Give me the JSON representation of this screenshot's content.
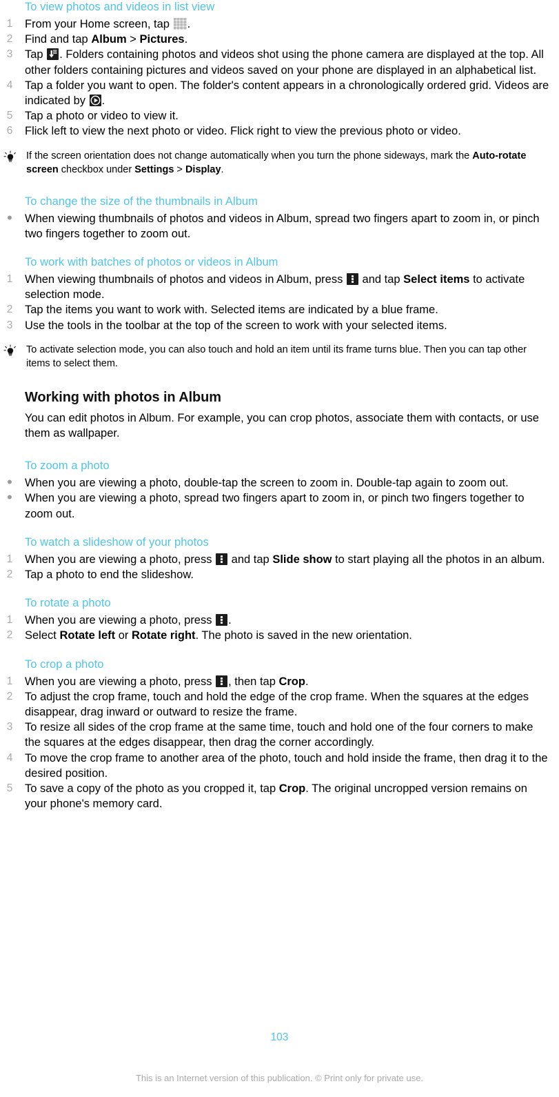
{
  "document": {
    "page_number": "103",
    "footer_note": "This is an Internet version of this publication. © Print only for private use.",
    "colors": {
      "heading_blue": "#4FC4E8",
      "list_marker_gray": "#A9A9A9",
      "footer_gray": "#AAAAAA",
      "body_black": "#000000"
    }
  },
  "sections": {
    "list_view": {
      "heading": "To view photos and videos in list view",
      "steps": [
        {
          "number": "1",
          "pre": "From your Home screen, tap ",
          "icon": "app-drawer-grid-icon",
          "post": "."
        },
        {
          "number": "2",
          "pre": "Find and tap ",
          "bold1": "Album",
          "mid": " > ",
          "bold2": "Pictures",
          "post": "."
        },
        {
          "number": "3",
          "pre": "Tap ",
          "icon": "folder-download-icon",
          "post": ". Folders containing photos and videos shot using the phone camera are displayed at the top. All other folders containing pictures and videos saved on your phone are displayed in an alphabetical list."
        },
        {
          "number": "4",
          "pre": "Tap a folder you want to open. The folder's content appears in a chronologically ordered grid. Videos are indicated by ",
          "icon": "video-play-icon",
          "post": "."
        },
        {
          "number": "5",
          "pre": "Tap a photo or video to view it."
        },
        {
          "number": "6",
          "pre": "Flick left to view the next photo or video. Flick right to view the previous photo or video."
        }
      ],
      "tip": {
        "icon": "lightbulb-tip-icon",
        "pre": "If the screen orientation does not change automatically when you turn the phone sideways, mark the ",
        "bold1": "Auto-rotate screen",
        "mid": " checkbox under ",
        "bold2": "Settings",
        "mid2": " > ",
        "bold3": "Display",
        "post": "."
      }
    },
    "thumbnail_size": {
      "heading": "To change the size of the thumbnails in Album",
      "bullets": [
        "When viewing thumbnails of photos and videos in Album, spread two fingers apart to zoom in, or pinch two fingers together to zoom out."
      ]
    },
    "batches": {
      "heading": "To work with batches of photos or videos in Album",
      "steps": [
        {
          "number": "1",
          "pre": "When viewing thumbnails of photos and videos in Album, press ",
          "icon": "overflow-menu-icon",
          "mid": " and tap ",
          "bold1": "Select items",
          "post": " to activate selection mode."
        },
        {
          "number": "2",
          "pre": "Tap the items you want to work with. Selected items are indicated by a blue frame."
        },
        {
          "number": "3",
          "pre": "Use the tools in the toolbar at the top of the screen to work with your selected items."
        }
      ],
      "tip": {
        "icon": "lightbulb-tip-icon",
        "pre": "To activate selection mode, you can also touch and hold an item until its frame turns blue. Then you can tap other items to select them."
      }
    },
    "working_with_photos": {
      "heading": "Working with photos in Album",
      "intro": "You can edit photos in Album. For example, you can crop photos, associate them with contacts, or use them as wallpaper."
    },
    "zoom_photo": {
      "heading": "To zoom a photo",
      "bullets": [
        "When you are viewing a photo, double-tap the screen to zoom in. Double-tap again to zoom out.",
        "When you are viewing a photo, spread two fingers apart to zoom in, or pinch two fingers together to zoom out."
      ]
    },
    "slideshow": {
      "heading": "To watch a slideshow of your photos",
      "steps": [
        {
          "number": "1",
          "pre": "When you are viewing a photo, press ",
          "icon": "overflow-menu-icon",
          "mid": " and tap ",
          "bold1": "Slide show",
          "post": " to start playing all the photos in an album."
        },
        {
          "number": "2",
          "pre": "Tap a photo to end the slideshow."
        }
      ]
    },
    "rotate_photo": {
      "heading": "To rotate a photo",
      "steps": [
        {
          "number": "1",
          "pre": "When you are viewing a photo, press ",
          "icon": "overflow-menu-icon",
          "post": "."
        },
        {
          "number": "2",
          "pre": "Select ",
          "bold1": "Rotate left",
          "mid": " or ",
          "bold2": "Rotate right",
          "post": ". The photo is saved in the new orientation."
        }
      ]
    },
    "crop_photo": {
      "heading": "To crop a photo",
      "steps": [
        {
          "number": "1",
          "pre": "When you are viewing a photo, press ",
          "icon": "overflow-menu-icon",
          "mid": ", then tap ",
          "bold1": "Crop",
          "post": "."
        },
        {
          "number": "2",
          "pre": "To adjust the crop frame, touch and hold the edge of the crop frame. When the squares at the edges disappear, drag inward or outward to resize the frame."
        },
        {
          "number": "3",
          "pre": "To resize all sides of the crop frame at the same time, touch and hold one of the four corners to make the squares at the edges disappear, then drag the corner accordingly."
        },
        {
          "number": "4",
          "pre": "To move the crop frame to another area of the photo, touch and hold inside the frame, then drag it to the desired position."
        },
        {
          "number": "5",
          "pre": "To save a copy of the photo as you cropped it, tap ",
          "bold1": "Crop",
          "post": ". The original uncropped version remains on your phone's memory card."
        }
      ]
    }
  }
}
